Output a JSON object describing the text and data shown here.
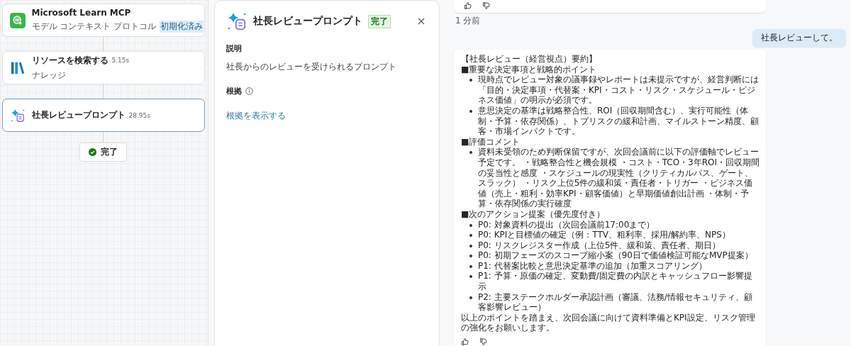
{
  "canvas": {
    "nodes": [
      {
        "kind": "mcp",
        "title": "Microsoft Learn MCP",
        "subtitle": "モデル コンテキスト プロトコル",
        "badge": "初期化済み",
        "selected": false
      },
      {
        "kind": "knowledge",
        "title": "リソースを検索する",
        "time": "5.15s",
        "subtitle": "ナレッジ",
        "selected": false
      },
      {
        "kind": "prompt",
        "title": "社長レビュープロンプト",
        "time": "28.95s",
        "selected": true
      }
    ],
    "done": {
      "label": "完了"
    }
  },
  "detail": {
    "title": "社長レビュープロンプト",
    "status": "完了",
    "description_heading": "説明",
    "description": "社長からのレビューを受けられるプロンプト",
    "basis_heading": "根拠",
    "basis_link": "根拠を表示する"
  },
  "chat": {
    "previous_time": "1 分前",
    "user_message": "社長レビューして。",
    "answer": {
      "heading": "【社長レビュー（経営視点）要約】",
      "sections": [
        {
          "heading": "■重要な決定事項と戦略的ポイント",
          "items": [
            "現時点でレビュー対象の議事録やレポートは未提示ですが、経営判断には「目的・決定事項・代替案・KPI・コスト・リスク・スケジュール・ビジネス価値」の明示が必須です。",
            "意思決定の基準は戦略整合性、ROI（回収期間含む）、実行可能性（体制・予算・依存関係）、トプリスクの緩和計画、マイルストーン精度、顧客・市場インパクトです。"
          ]
        },
        {
          "heading": "■評価コメント",
          "items": [
            "資料未受領のため判断保留ですが、次回会議前に以下の評価軸でレビュー予定です。 ・戦略整合性と機会規模 ・コスト・TCO・3年ROI・回収期間の妥当性と感度 ・スケジュールの現実性（クリティカルパス、ゲート、スラック） ・リスク上位5件の緩和策・責任者・トリガー ・ビジネス価値（売上・粗利・効率KPI・顧客価値）と早期価値創出計画 ・体制・予算・依存関係の実行確度"
          ]
        },
        {
          "heading": "■次のアクション提案（優先度付き）",
          "items": [
            "P0: 対象資料の提出（次回会議前17:00まで）",
            "P0: KPIと目標値の確定（例：TTV、粗利率、採用/解約率、NPS）",
            "P0: リスクレジスター作成（上位5件、緩和策、責任者、期日）",
            "P0: 初期フェーズのスコープ縮小案（90日で価値検証可能なMVP提案）",
            "P1: 代替案比較と意思決定基準の追加（加重スコアリング）",
            "P1: 予算・原価の確定、変動費/固定費の内訳とキャッシュフロー影響提示",
            "P2: 主要ステークホルダー承認計画（審議、法務/情報セキュリティ、顧客影響レビュー）"
          ]
        }
      ],
      "closing": "以上のポイントを踏まえ、次回会議に向けて資料準備とKPI設定、リスク管理の強化をお願いします。"
    }
  }
}
